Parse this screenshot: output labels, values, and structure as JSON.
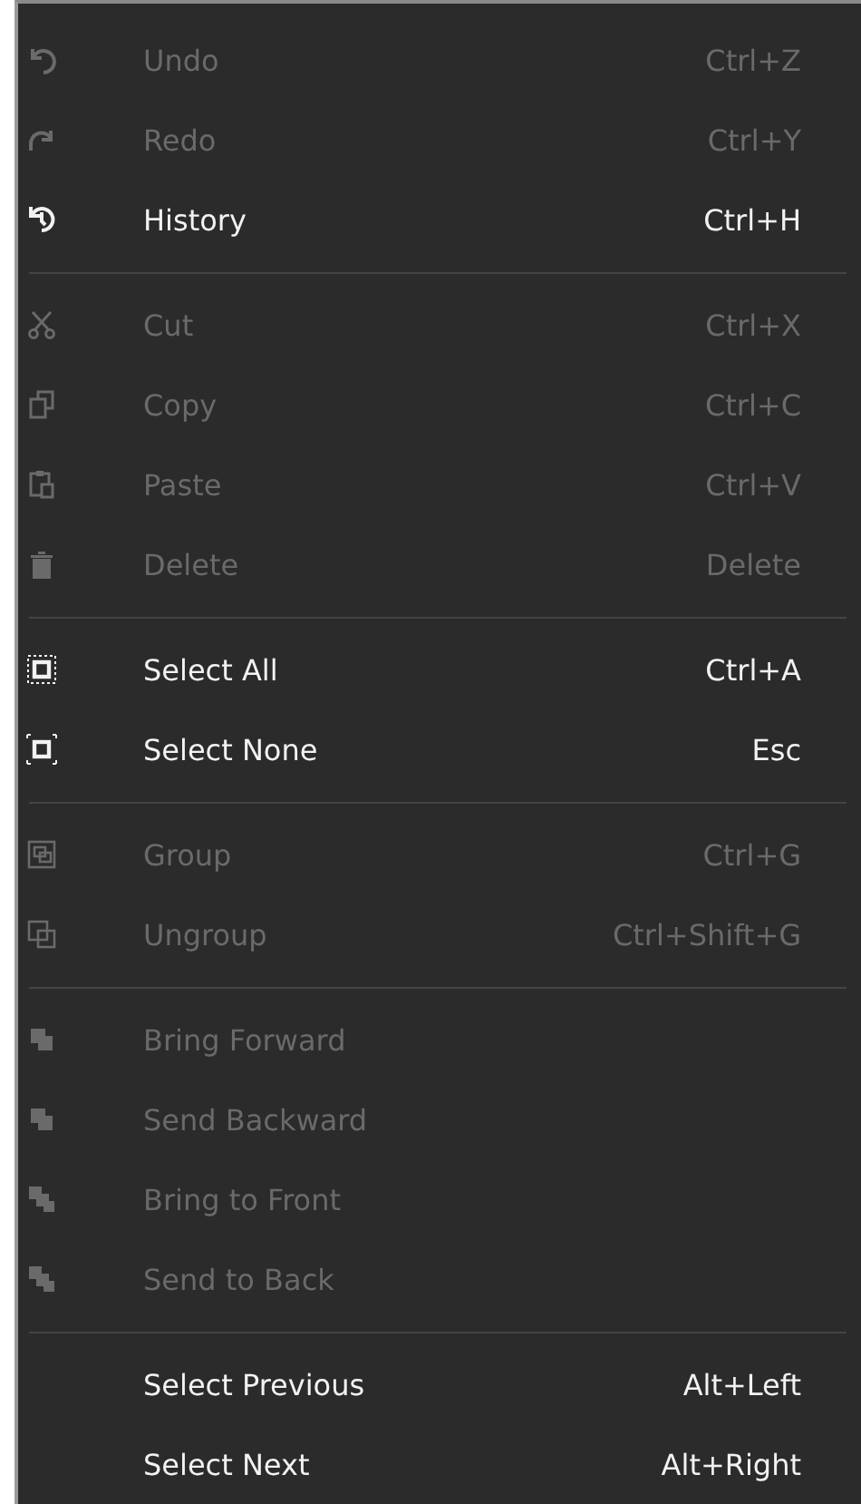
{
  "menu": {
    "groups": [
      {
        "items": [
          {
            "label": "Undo",
            "shortcut": "Ctrl+Z",
            "disabled": true
          },
          {
            "label": "Redo",
            "shortcut": "Ctrl+Y",
            "disabled": true
          },
          {
            "label": "History",
            "shortcut": "Ctrl+H",
            "disabled": false
          }
        ]
      },
      {
        "items": [
          {
            "label": "Cut",
            "shortcut": "Ctrl+X",
            "disabled": true
          },
          {
            "label": "Copy",
            "shortcut": "Ctrl+C",
            "disabled": true
          },
          {
            "label": "Paste",
            "shortcut": "Ctrl+V",
            "disabled": true
          },
          {
            "label": "Delete",
            "shortcut": "Delete",
            "disabled": true
          }
        ]
      },
      {
        "items": [
          {
            "label": "Select All",
            "shortcut": "Ctrl+A",
            "disabled": false
          },
          {
            "label": "Select None",
            "shortcut": "Esc",
            "disabled": false
          }
        ]
      },
      {
        "items": [
          {
            "label": "Group",
            "shortcut": "Ctrl+G",
            "disabled": true
          },
          {
            "label": "Ungroup",
            "shortcut": "Ctrl+Shift+G",
            "disabled": true
          }
        ]
      },
      {
        "items": [
          {
            "label": "Bring Forward",
            "disabled": true
          },
          {
            "label": "Send Backward",
            "disabled": true
          },
          {
            "label": "Bring to Front",
            "disabled": true
          },
          {
            "label": "Send to Back",
            "disabled": true
          }
        ]
      },
      {
        "items": [
          {
            "label": "Select Previous",
            "shortcut": "Alt+Left",
            "disabled": false
          },
          {
            "label": "Select Next",
            "shortcut": "Alt+Right",
            "disabled": false
          }
        ]
      }
    ]
  }
}
